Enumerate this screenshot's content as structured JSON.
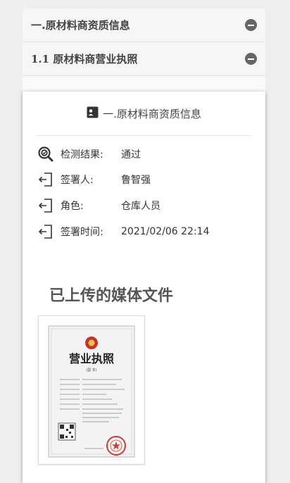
{
  "sections": [
    {
      "title": "一.原材料商资质信息"
    },
    {
      "title": "1.1 原材料商营业执照"
    }
  ],
  "card": {
    "header_title": "一.原材料商资质信息",
    "rows": [
      {
        "label": "检测结果:",
        "value": "通过",
        "icon": "inspection-icon"
      },
      {
        "label": "签署人:",
        "value": "鲁智强",
        "icon": "sign-in-icon"
      },
      {
        "label": "角色:",
        "value": "仓库人员",
        "icon": "sign-in-icon"
      },
      {
        "label": "签署时间:",
        "value": "2021/02/06 22:14",
        "icon": "sign-in-icon"
      }
    ],
    "media_title": "已上传的媒体文件",
    "license": {
      "title": "营业执照",
      "copy": "(副 本)"
    }
  }
}
